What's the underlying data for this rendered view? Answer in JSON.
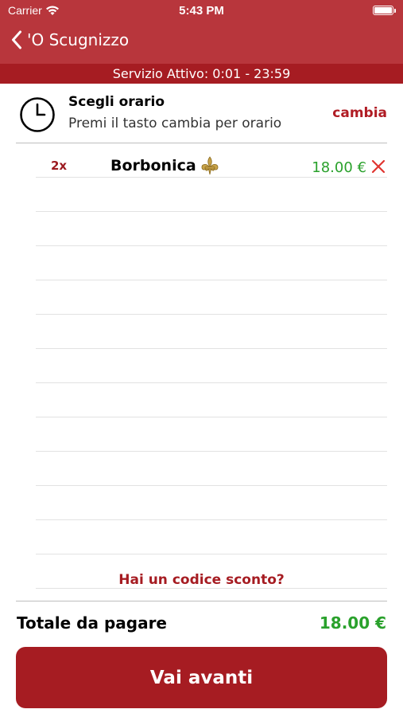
{
  "status_bar": {
    "carrier": "Carrier",
    "time": "5:43 PM"
  },
  "nav": {
    "back_label": "'O Scugnizzo"
  },
  "service": {
    "text": "Servizio Attivo: 0:01 - 23:59"
  },
  "time_select": {
    "title": "Scegli orario",
    "subtitle": "Premi il tasto cambia per orario",
    "change_label": "cambia"
  },
  "items": [
    {
      "qty": "2x",
      "name": "Borbonica",
      "price": "18.00 €"
    }
  ],
  "discount": {
    "label": "Hai un codice sconto?"
  },
  "total": {
    "label": "Totale da pagare",
    "value": "18.00 €"
  },
  "cta": {
    "label": "Vai avanti"
  },
  "colors": {
    "header": "#b8363c",
    "accent": "#a61c22",
    "price_green": "#2aa12c",
    "remove_red": "#e0342f"
  },
  "icons": {
    "wifi": "wifi-icon",
    "battery": "battery-icon",
    "back": "chevron-left-icon",
    "clock": "clock-icon",
    "product_badge": "fleur-de-lis-icon",
    "remove": "close-icon"
  }
}
